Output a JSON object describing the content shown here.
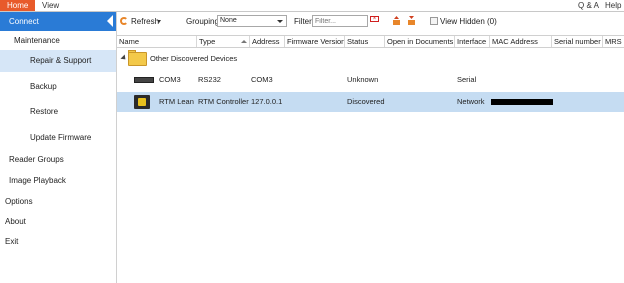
{
  "menu": {
    "home": "Home",
    "view": "View",
    "qa": "Q & A",
    "help": "Help"
  },
  "sidebar": {
    "connect": "Connect",
    "maintenance": "Maintenance",
    "sub_items": [
      {
        "label": "Repair & Support",
        "active": true
      },
      {
        "label": "Backup",
        "active": false
      },
      {
        "label": "Restore",
        "active": false
      },
      {
        "label": "Update Firmware",
        "active": false
      }
    ],
    "reader_groups": "Reader Groups",
    "image_playback": "Image Playback",
    "options": "Options",
    "about": "About",
    "exit": "Exit"
  },
  "toolbar": {
    "refresh_label": "Refresh",
    "grouping_label": "Grouping",
    "grouping_value": "None",
    "filter_label": "Filter",
    "filter_placeholder": "Filter...",
    "view_hidden_label": "View Hidden (0)"
  },
  "grid": {
    "columns": [
      "Name",
      "Type",
      "Address",
      "Firmware Version",
      "Status",
      "Open in Documents",
      "Interface",
      "MAC Address",
      "Serial number",
      "MRS"
    ],
    "group_label": "Other Discovered Devices",
    "rows": [
      {
        "name": "COM3",
        "type": "RS232",
        "address": "COM3",
        "firmware": "",
        "status": "Unknown",
        "open_in_documents": "",
        "interface": "Serial",
        "mac": "",
        "serial": "",
        "selected": false
      },
      {
        "name": "RTM Lean",
        "type": "RTM Controller",
        "address": "127.0.0.1",
        "firmware": "",
        "status": "Discovered",
        "open_in_documents": "",
        "interface": "Network",
        "mac": "",
        "serial": "",
        "selected": true
      }
    ]
  },
  "colors": {
    "home_tab": "#e85a2a",
    "connect_bg": "#2a7bd6",
    "active_sub": "#d6e6f7",
    "selected_row": "#c5dcf2"
  }
}
